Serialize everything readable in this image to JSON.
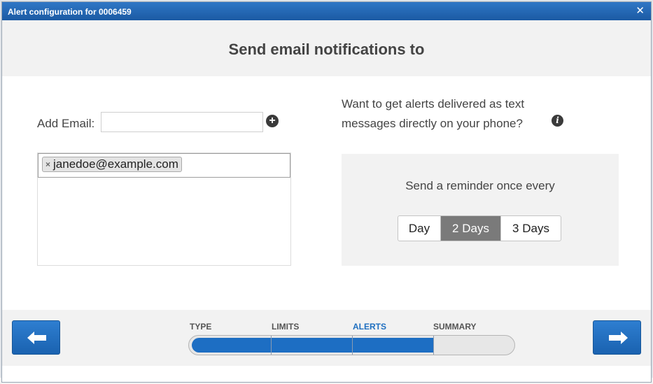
{
  "dialog": {
    "title": "Alert configuration for 0006459",
    "close_glyph": "✕",
    "close_icon": "close-icon"
  },
  "heading": "Send email notifications to",
  "email": {
    "add_label": "Add Email:",
    "input_value": "",
    "input_placeholder": "",
    "add_icon": "plus-circle-icon",
    "add_glyph": "+",
    "recipients": [
      {
        "address": "janedoe@example.com",
        "remove_glyph": "×"
      }
    ]
  },
  "sms": {
    "prompt": "Want to get alerts delivered as text messages directly on your phone?",
    "info_icon": "info-icon",
    "info_glyph": "i"
  },
  "reminder": {
    "label": "Send a reminder once every",
    "options": [
      "Day",
      "2 Days",
      "3 Days"
    ],
    "selected": "2 Days"
  },
  "wizard": {
    "steps": [
      "TYPE",
      "LIMITS",
      "ALERTS",
      "SUMMARY"
    ],
    "current_step": "ALERTS",
    "progress_fraction": 0.75,
    "back_icon": "arrow-left-icon",
    "next_icon": "arrow-right-icon"
  },
  "colors": {
    "titlebar": "#1b5aa3",
    "accent": "#1d6ec3",
    "selected_option": "#7a7a7a"
  }
}
